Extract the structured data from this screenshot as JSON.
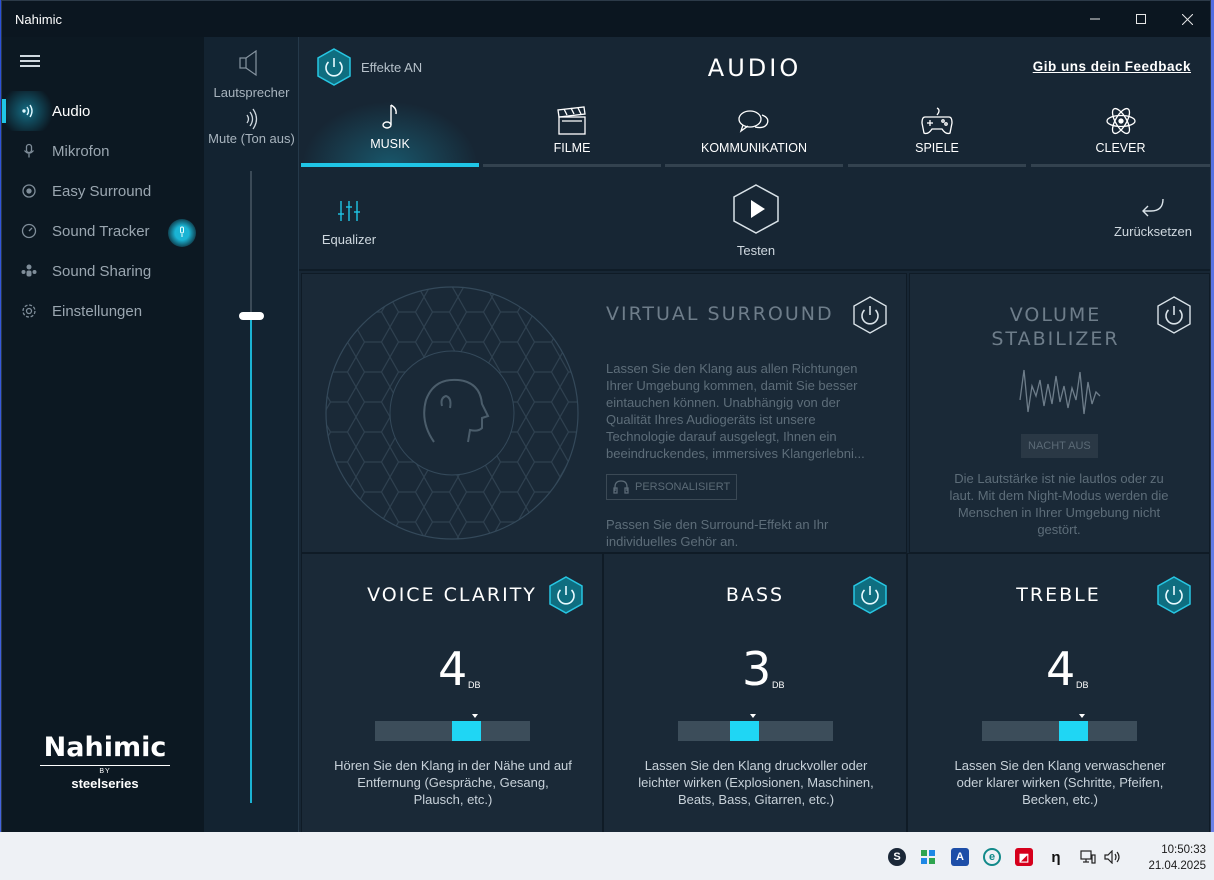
{
  "window": {
    "title": "Nahimic"
  },
  "sidebar": {
    "items": [
      {
        "label": "Audio",
        "icon": "audio-wave-icon"
      },
      {
        "label": "Mikrofon",
        "icon": "microphone-icon"
      },
      {
        "label": "Easy Surround",
        "icon": "surround-icon"
      },
      {
        "label": "Sound Tracker",
        "icon": "compass-icon"
      },
      {
        "label": "Sound Sharing",
        "icon": "share-icon"
      },
      {
        "label": "Einstellungen",
        "icon": "gear-icon"
      }
    ],
    "logo": {
      "brand": "Nahimic",
      "by": "BY",
      "company": "steelseries"
    }
  },
  "volume": {
    "device_label": "Lautsprecher",
    "mute_label": "Mute (Ton aus)",
    "level_percent": 77
  },
  "header": {
    "effects_label": "Effekte AN",
    "title": "AUDIO",
    "feedback": "Gib uns dein Feedback"
  },
  "tabs": [
    {
      "label": "MUSIK",
      "icon": "music-note-icon"
    },
    {
      "label": "FILME",
      "icon": "clapperboard-icon"
    },
    {
      "label": "KOMMUNIKATION",
      "icon": "chat-bubbles-icon"
    },
    {
      "label": "SPIELE",
      "icon": "gamepad-icon"
    },
    {
      "label": "CLEVER",
      "icon": "atom-icon"
    }
  ],
  "toolbar": {
    "equalizer": "Equalizer",
    "test": "Testen",
    "reset": "Zurücksetzen"
  },
  "virtual_surround": {
    "title": "VIRTUAL SURROUND",
    "description": "Lassen Sie den Klang aus allen Richtungen Ihrer Umgebung kommen, damit Sie besser eintauchen können. Unabhängig von der Qualität Ihres Audiogeräts ist unsere Technologie darauf ausgelegt, Ihnen ein beeindruckendes, immersives Klangerlebni...",
    "button": "PERSONALISIERT",
    "note": "Passen Sie den Surround-Effekt an Ihr individuelles Gehör an."
  },
  "volume_stabilizer": {
    "title_line1": "VOLUME",
    "title_line2": "STABILIZER",
    "button": "NACHT AUS",
    "description": "Die Lautstärke ist nie lautlos oder zu laut. Mit dem Night-Modus werden die Menschen in Ihrer Umgebung nicht gestört."
  },
  "effects": [
    {
      "title": "VOICE CLARITY",
      "value": "4",
      "unit": "DB",
      "level": 4,
      "description": "Hören Sie den Klang in der Nähe und auf Entfernung (Gespräche, Gesang, Plausch, etc.)"
    },
    {
      "title": "BASS",
      "value": "3",
      "unit": "DB",
      "level": 3,
      "description": "Lassen Sie den Klang druckvoller oder leichter wirken (Explosionen, Maschinen, Beats, Bass, Gitarren, etc.)"
    },
    {
      "title": "TREBLE",
      "value": "4",
      "unit": "DB",
      "level": 4,
      "description": "Lassen Sie den Klang verwaschener oder klarer wirken (Schritte, Pfeifen, Becken, etc.)"
    }
  ],
  "taskbar": {
    "time": "10:50:33",
    "date": "21.04.2025"
  },
  "colors": {
    "accent": "#1fc5e6",
    "panel": "#1a2937",
    "sidebar": "#0c1822"
  }
}
